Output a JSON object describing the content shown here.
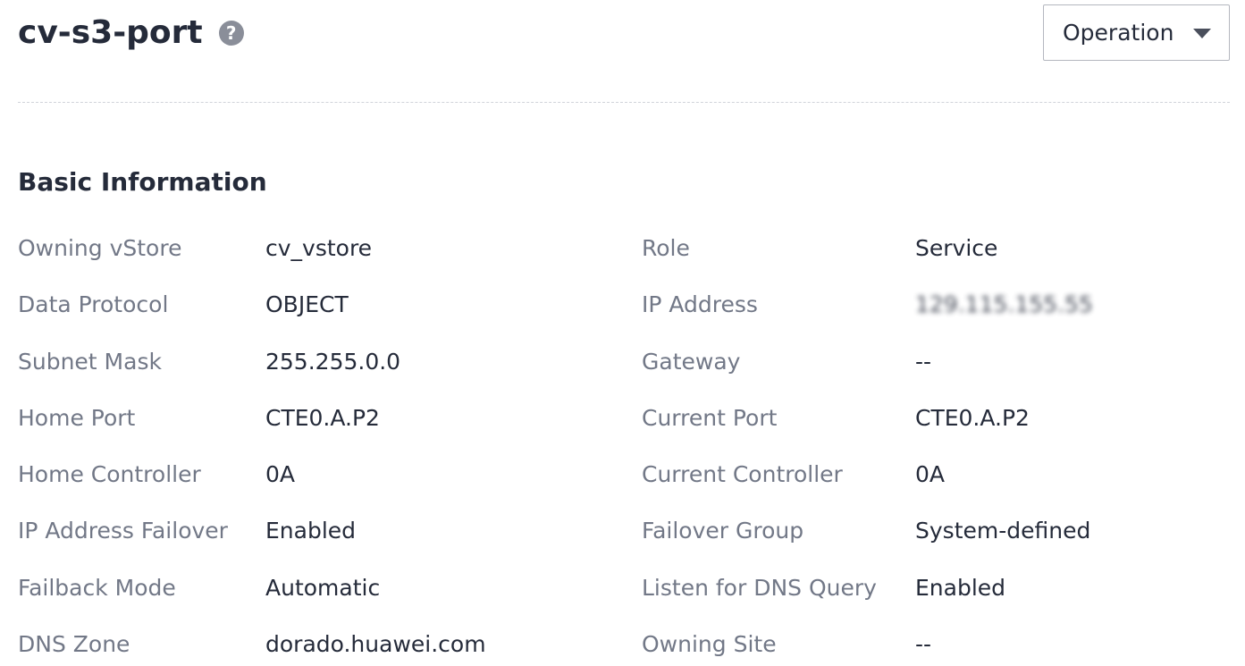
{
  "header": {
    "title": "cv-s3-port",
    "help_icon": "question-circle-icon",
    "operation_label": "Operation"
  },
  "section": {
    "title": "Basic Information"
  },
  "fields": [
    {
      "label": "Owning vStore",
      "value": "cv_vstore",
      "label2": "Role",
      "value2": "Service"
    },
    {
      "label": "Data Protocol",
      "value": "OBJECT",
      "label2": "IP Address",
      "value2": "129.115.155.55"
    },
    {
      "label": "Subnet Mask",
      "value": "255.255.0.0",
      "label2": "Gateway",
      "value2": "--"
    },
    {
      "label": "Home Port",
      "value": "CTE0.A.P2",
      "label2": "Current Port",
      "value2": "CTE0.A.P2"
    },
    {
      "label": "Home Controller",
      "value": "0A",
      "label2": "Current Controller",
      "value2": "0A"
    },
    {
      "label": "IP Address Failover",
      "value": "Enabled",
      "label2": "Failover Group",
      "value2": "System-defined"
    },
    {
      "label": "Failback Mode",
      "value": "Automatic",
      "label2": "Listen for DNS Query",
      "value2": "Enabled"
    },
    {
      "label": "DNS Zone",
      "value": "dorado.huawei.com",
      "label2": "Owning Site",
      "value2": "--"
    }
  ]
}
